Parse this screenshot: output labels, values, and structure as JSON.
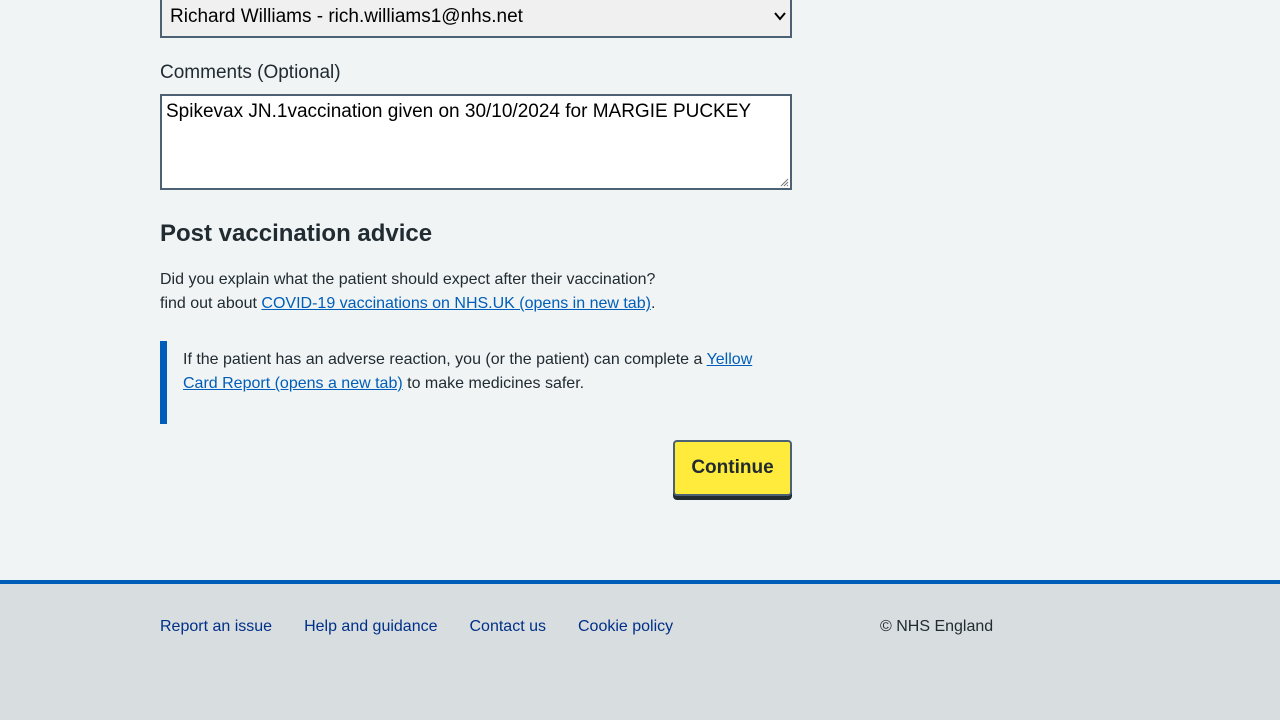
{
  "form": {
    "user_select": {
      "selected_value": "Richard Williams - rich.williams1@nhs.net"
    },
    "comments": {
      "label": "Comments (Optional)",
      "value": "Spikevax JN.1vaccination given on 30/10/2024 for MARGIE PUCKEY"
    }
  },
  "advice": {
    "heading": "Post vaccination advice",
    "question": "Did you explain what the patient should expect after their vaccination?",
    "find_out_prefix": "find out about ",
    "covid_link": "COVID-19 vaccinations on NHS.UK (opens in new tab)",
    "find_out_suffix": ".",
    "inset_prefix": "If the patient has an adverse reaction, you (or the patient) can complete a ",
    "yellow_card_link_part1": "Yellow",
    "yellow_card_link_part2": "Card Report (opens a new tab)",
    "inset_suffix": " to make medicines safer."
  },
  "actions": {
    "continue_label": "Continue"
  },
  "footer": {
    "links": [
      "Report an issue",
      "Help and guidance",
      "Contact us",
      "Cookie policy"
    ],
    "copyright": "© NHS England"
  },
  "colors": {
    "background": "#f0f4f5",
    "link": "#005eb8",
    "button": "#ffeb3b",
    "footer_bg": "#d8dde0",
    "footer_link": "#003087"
  }
}
